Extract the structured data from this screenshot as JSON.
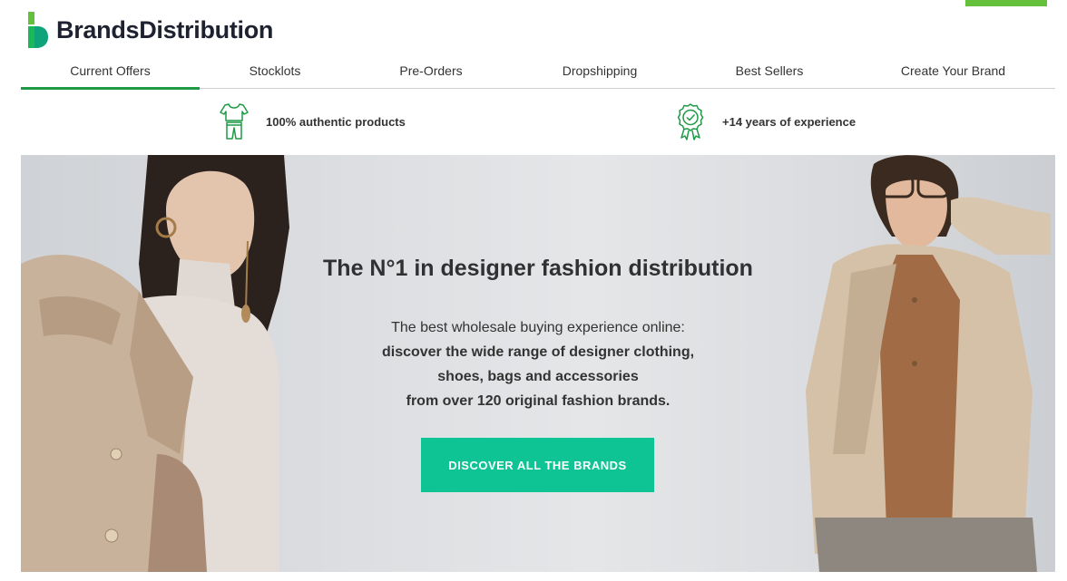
{
  "brand": {
    "name": "BrandsDistribution",
    "primary_color": "#1e9a45",
    "logo_green_light": "#65c13b",
    "logo_green_dark": "#0fa37a"
  },
  "nav": {
    "items": [
      {
        "label": "Current Offers",
        "active": true
      },
      {
        "label": "Stocklots",
        "active": false
      },
      {
        "label": "Pre-Orders",
        "active": false
      },
      {
        "label": "Dropshipping",
        "active": false
      },
      {
        "label": "Best Sellers",
        "active": false
      },
      {
        "label": "Create Your Brand",
        "active": false
      }
    ]
  },
  "features": [
    {
      "icon": "clothing-icon",
      "text": "100% authentic products"
    },
    {
      "icon": "award-badge-icon",
      "text": "+14 years of experience"
    }
  ],
  "hero": {
    "title": "The N°1 in designer fashion distribution",
    "line1": "The best wholesale buying experience online:",
    "line2": "discover the wide range of designer clothing,",
    "line3": "shoes, bags and accessories",
    "line4": "from over 120 original fashion brands.",
    "cta_label": "DISCOVER ALL THE BRANDS",
    "cta_color": "#0fc494"
  }
}
